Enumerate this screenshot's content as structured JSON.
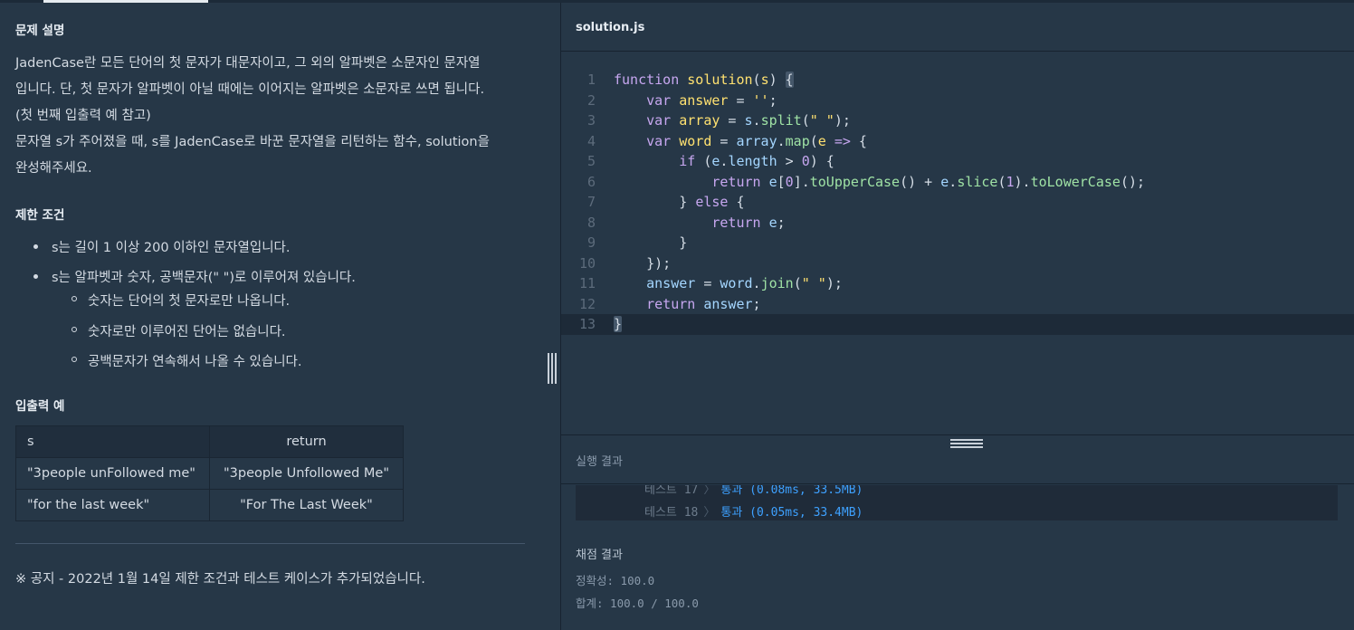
{
  "problem": {
    "desc_title": "문제 설명",
    "desc_lines": [
      "JadenCase란 모든 단어의 첫 문자가 대문자이고, 그 외의 알파벳은 소문자인 문자열",
      "입니다. 단, 첫 문자가 알파벳이 아닐 때에는 이어지는 알파벳은 소문자로 쓰면 됩니다.",
      "(첫 번째 입출력 예 참고)",
      "문자열 s가 주어졌을 때, s를 JadenCase로 바꾼 문자열을 리턴하는 함수, solution을",
      "완성해주세요."
    ],
    "constraints_title": "제한 조건",
    "constraints": [
      "s는 길이 1 이상 200 이하인 문자열입니다.",
      "s는 알파벳과 숫자, 공백문자(\" \")로 이루어져 있습니다."
    ],
    "sub_constraints": [
      "숫자는 단어의 첫 문자로만 나옵니다.",
      "숫자로만 이루어진 단어는 없습니다.",
      "공백문자가 연속해서 나올 수 있습니다."
    ],
    "examples_title": "입출력 예",
    "table": {
      "headers": [
        "s",
        "return"
      ],
      "rows": [
        [
          "\"3people unFollowed me\"",
          "\"3people Unfollowed Me\""
        ],
        [
          "\"for the last week\"",
          "\"For The Last Week\""
        ]
      ]
    },
    "notice": "※ 공지 - 2022년 1월 14일 제한 조건과 테스트 케이스가 추가되었습니다."
  },
  "editor": {
    "filename": "solution.js",
    "line_numbers": [
      "1",
      "2",
      "3",
      "4",
      "5",
      "6",
      "7",
      "8",
      "9",
      "10",
      "11",
      "12",
      "13"
    ]
  },
  "results": {
    "title": "실행 결과",
    "rows": [
      {
        "label": "테스트 17",
        "status": "통과 (0.08ms, 33.5MB)"
      },
      {
        "label": "테스트 18",
        "status": "통과 (0.05ms, 33.4MB)"
      }
    ],
    "grading_title": "채점 결과",
    "accuracy": "정확성: 100.0",
    "total": "합계: 100.0 / 100.0"
  },
  "colors": {
    "background": "#263747",
    "pass": "#3ea1ff",
    "keyword": "#c7a7f0",
    "function": "#ffe170",
    "method": "#9fe2a5"
  }
}
